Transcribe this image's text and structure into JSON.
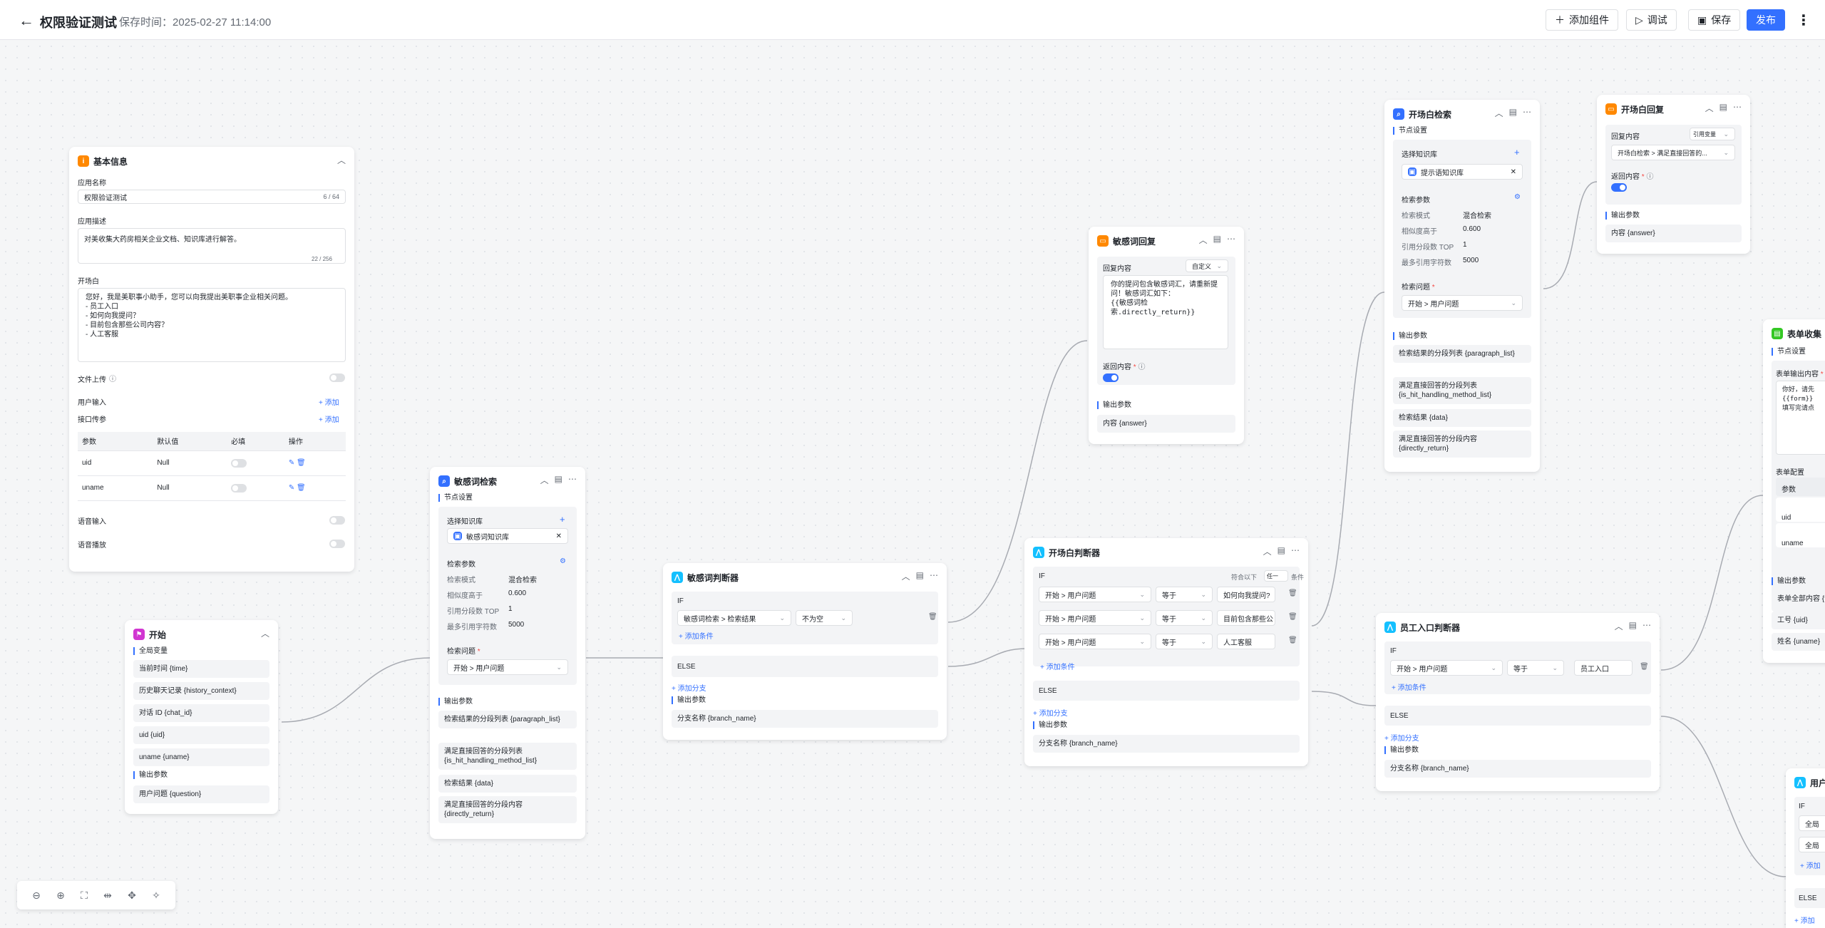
{
  "header": {
    "title": "权限验证测试",
    "save_time": "保存时间：2025-02-27 11:14:00",
    "add_component": "添加组件",
    "debug": "调试",
    "save": "保存",
    "publish": "发布"
  },
  "basic_info": {
    "title": "基本信息",
    "app_name_label": "应用名称",
    "app_name_value": "权限验证测试",
    "app_name_count": "6 / 64",
    "desc_label": "应用描述",
    "desc_value": "对美收集大药房相关企业文档、知识库进行解答。",
    "desc_count": "22 / 256",
    "opening_label": "开场白",
    "opening_text": "您好，我是美职事小助手，您可以向我提出美职事企业相关问题。\n- 员工入口\n- 如何向我提问？\n- 目前包含那些公司内容？\n- 人工客服",
    "file_upload": "文件上传",
    "user_input": "用户输入",
    "interface_params": "接口传参",
    "add": "添加",
    "table_headers": [
      "参数",
      "默认值",
      "必填",
      "操作"
    ],
    "rows": [
      {
        "param": "uid",
        "default": "Null"
      },
      {
        "param": "uname",
        "default": "Null"
      }
    ],
    "voice_input": "语音输入",
    "voice_play": "语音播放"
  },
  "start": {
    "title": "开始",
    "global_vars": "全局变量",
    "vars": [
      "当前时间 {time}",
      "历史聊天记录 {history_context}",
      "对话 ID {chat_id}",
      "uid {uid}",
      "uname {uname}"
    ],
    "output": "输出参数",
    "outputs": [
      "用户问题 {question}"
    ]
  },
  "sensitive_search": {
    "title": "敏感词检索",
    "node_settings": "节点设置",
    "select_kb": "选择知识库",
    "kb_name": "敏感词知识库",
    "search_params": "检索参数",
    "mode_label": "检索模式",
    "mode_value": "混合检索",
    "sim_label": "相似度高于",
    "sim_value": "0.600",
    "top_label": "引用分段数 TOP",
    "top_value": "1",
    "max_label": "最多引用字符数",
    "max_value": "5000",
    "question_label": "检索问题",
    "question_value": "开始 > 用户问题",
    "output": "输出参数",
    "outputs": [
      "检索结果的分段列表 {paragraph_list}",
      "满足直接回答的分段列表 {is_hit_handling_method_list}",
      "检索结果 {data}",
      "满足直接回答的分段内容 {directly_return}"
    ]
  },
  "sensitive_judge": {
    "title": "敏感词判断器",
    "if": "IF",
    "cond_field": "敏感词检索 > 检索结果",
    "cond_op": "不为空",
    "add_cond": "添加条件",
    "else": "ELSE",
    "add_branch": "添加分支",
    "output": "输出参数",
    "branch_name": "分支名称 {branch_name}"
  },
  "sensitive_reply": {
    "title": "敏感词回复",
    "content_label": "回复内容",
    "content_mode": "自定义",
    "content_text": "你的提问包含敏感词汇，请重新提\n问！敏感词汇如下：\n{{敏感词检\n索.directly_return}}",
    "return_label": "返回内容",
    "output": "输出参数",
    "output_item": "内容 {answer}"
  },
  "opening_judge": {
    "title": "开场白判断器",
    "if": "IF",
    "match_label": "符合以下",
    "match_mode": "任一",
    "cond_word": "条件",
    "conds": [
      {
        "field": "开始 > 用户问题",
        "op": "等于",
        "value": "如何向我提问?"
      },
      {
        "field": "开始 > 用户问题",
        "op": "等于",
        "value": "目前包含那些公"
      },
      {
        "field": "开始 > 用户问题",
        "op": "等于",
        "value": "人工客服"
      }
    ],
    "add_cond": "添加条件",
    "else": "ELSE",
    "add_branch": "添加分支",
    "output": "输出参数",
    "branch_name": "分支名称 {branch_name}"
  },
  "opening_search": {
    "title": "开场白检索",
    "node_settings": "节点设置",
    "select_kb": "选择知识库",
    "kb_name": "提示语知识库",
    "search_params": "检索参数",
    "mode_label": "检索模式",
    "mode_value": "混合检索",
    "sim_label": "相似度高于",
    "sim_value": "0.600",
    "top_label": "引用分段数 TOP",
    "top_value": "1",
    "max_label": "最多引用字符数",
    "max_value": "5000",
    "question_label": "检索问题",
    "question_value": "开始 > 用户问题",
    "output": "输出参数",
    "outputs": [
      "检索结果的分段列表 {paragraph_list}",
      "满足直接回答的分段列表 {is_hit_handling_method_list}",
      "检索结果 {data}",
      "满足直接回答的分段内容 {directly_return}"
    ]
  },
  "opening_reply": {
    "title": "开场白回复",
    "content_label": "回复内容",
    "content_mode": "引用变量",
    "content_value": "开场白检索 > 满足直接回答的...",
    "return_label": "返回内容",
    "output": "输出参数",
    "output_item": "内容 {answer}"
  },
  "employee_judge": {
    "title": "员工入口判断器",
    "if": "IF",
    "cond_field": "开始 > 用户问题",
    "cond_op": "等于",
    "cond_value": "员工入口",
    "add_cond": "添加条件",
    "else": "ELSE",
    "add_branch": "添加分支",
    "output": "输出参数",
    "branch_name": "分支名称 {branch_name}"
  },
  "form_collect": {
    "title": "表单收集",
    "node_settings": "节点设置",
    "output_label": "表单输出内容",
    "content_text": "你好，请先\n{{form}}\n填写完请点",
    "config_label": "表单配置",
    "col_param": "参数",
    "rows": [
      "uid",
      "uname"
    ],
    "output": "输出参数",
    "outputs": [
      "表单全部内容 {f",
      "工号 {uid}",
      "姓名 {uname}"
    ]
  },
  "user_judge": {
    "title": "用户",
    "if": "IF",
    "conds": [
      "全局",
      "全局"
    ],
    "add_cond": "添加",
    "else": "ELSE",
    "add_branch": "添加"
  }
}
